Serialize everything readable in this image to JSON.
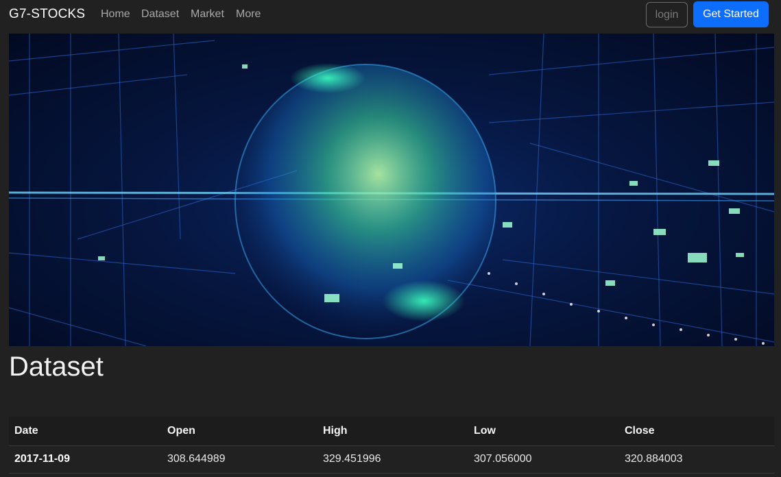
{
  "nav": {
    "brand": "G7-STOCKS",
    "links": [
      "Home",
      "Dataset",
      "Market",
      "More"
    ],
    "login_label": "login",
    "get_started_label": "Get Started"
  },
  "hero": {
    "image_icon": "digital-globe-image"
  },
  "main": {
    "title": "Dataset",
    "table": {
      "columns": [
        "Date",
        "Open",
        "High",
        "Low",
        "Close"
      ],
      "rows": [
        [
          "2017-11-09",
          "308.644989",
          "329.451996",
          "307.056000",
          "320.884003"
        ]
      ]
    }
  },
  "colors": {
    "background": "#212121",
    "primary": "#0d6efd",
    "hero_glow": "#39f0b0"
  }
}
